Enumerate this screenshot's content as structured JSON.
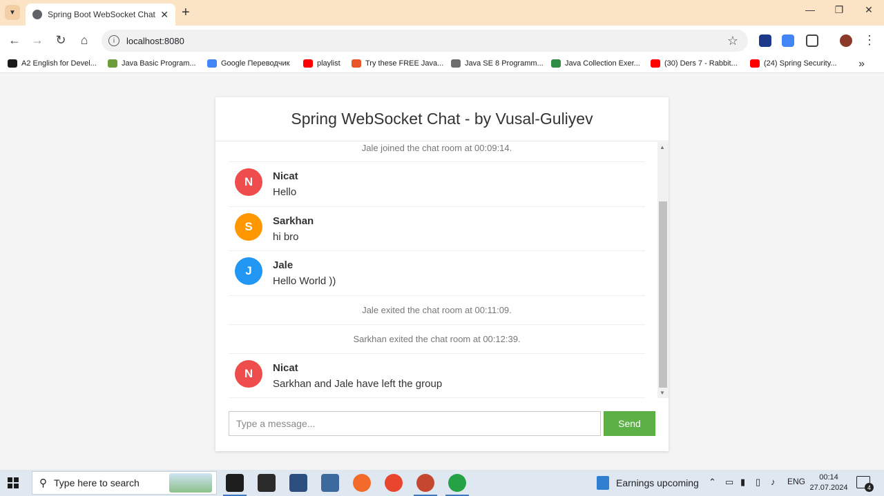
{
  "browser": {
    "tab_title": "Spring Boot WebSocket Chat Ap",
    "url": "localhost:8080",
    "bookmarks": [
      {
        "label": "A2 English for Devel...",
        "color": "#1a1a1a"
      },
      {
        "label": "Java Basic Program...",
        "color": "#6b9d3a"
      },
      {
        "label": "Google Переводчик",
        "color": "#4285f4"
      },
      {
        "label": "playlist",
        "color": "#ff0000"
      },
      {
        "label": "Try these FREE Java...",
        "color": "#e8562a"
      },
      {
        "label": "Java SE 8 Programm...",
        "color": "#6d6d6d"
      },
      {
        "label": "Java Collection Exer...",
        "color": "#2f8d46"
      },
      {
        "label": "(30) Ders 7 - Rabbit...",
        "color": "#ff0000"
      },
      {
        "label": "(24) Spring Security...",
        "color": "#ff0000"
      }
    ]
  },
  "chat": {
    "title": "Spring WebSocket Chat - by Vusal-Guliyev",
    "messages": [
      {
        "type": "event",
        "text": "Jale joined the chat room at 00:09:14."
      },
      {
        "type": "chat",
        "initial": "N",
        "sender": "Nicat",
        "content": "Hello",
        "color": "#ef4d4d"
      },
      {
        "type": "chat",
        "initial": "S",
        "sender": "Sarkhan",
        "content": "hi bro",
        "color": "#ff9800"
      },
      {
        "type": "chat",
        "initial": "J",
        "sender": "Jale",
        "content": "Hello World ))",
        "color": "#2196f3"
      },
      {
        "type": "event",
        "text": "Jale exited the chat room at 00:11:09."
      },
      {
        "type": "event",
        "text": "Sarkhan exited the chat room at 00:12:39."
      },
      {
        "type": "chat",
        "initial": "N",
        "sender": "Nicat",
        "content": "Sarkhan and Jale have left the group",
        "color": "#ef4d4d"
      }
    ],
    "input_placeholder": "Type a message...",
    "send_label": "Send"
  },
  "taskbar": {
    "search_text": "Type here to search",
    "news_label": "Earnings upcoming",
    "language": "ENG",
    "time": "00:14",
    "date": "27.07.2024",
    "notification_count": "4"
  }
}
